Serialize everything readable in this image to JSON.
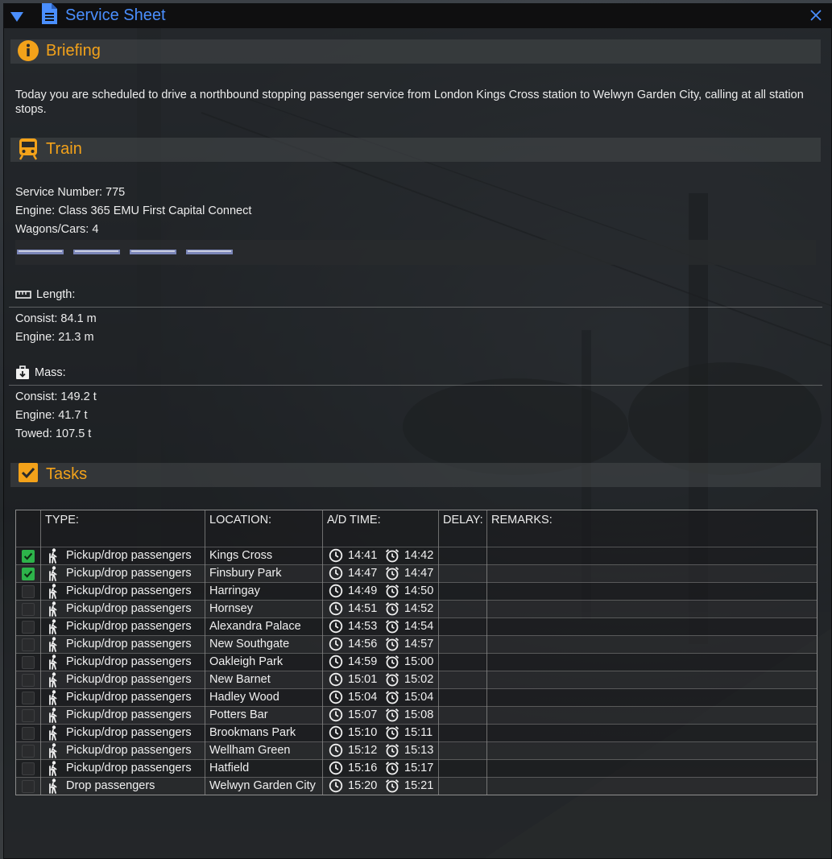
{
  "window": {
    "title": "Service Sheet"
  },
  "briefing": {
    "heading": "Briefing",
    "text": "Today you are scheduled to drive a northbound stopping passenger service from London Kings Cross station to Welwyn Garden City, calling at all station stops."
  },
  "train": {
    "heading": "Train",
    "service_number": "Service Number: 775",
    "engine": "Engine: Class 365 EMU First Capital Connect",
    "wagons": "Wagons/Cars: 4",
    "wagon_count": 4,
    "length": {
      "label": "Length:",
      "consist": "Consist: 84.1 m",
      "engine": "Engine: 21.3 m"
    },
    "mass": {
      "label": "Mass:",
      "consist": "Consist: 149.2 t",
      "engine": "Engine: 41.7 t",
      "towed": "Towed: 107.5 t"
    }
  },
  "tasks": {
    "heading": "Tasks",
    "columns": {
      "type": "TYPE:",
      "location": "LOCATION:",
      "time": "A/D TIME:",
      "delay": "DELAY:",
      "remarks": "REMARKS:"
    },
    "rows": [
      {
        "done": true,
        "type": "Pickup/drop passengers",
        "location": "Kings Cross",
        "arr": "14:41",
        "dep": "14:42"
      },
      {
        "done": true,
        "type": "Pickup/drop passengers",
        "location": "Finsbury Park",
        "arr": "14:47",
        "dep": "14:47"
      },
      {
        "done": false,
        "type": "Pickup/drop passengers",
        "location": "Harringay",
        "arr": "14:49",
        "dep": "14:50"
      },
      {
        "done": false,
        "type": "Pickup/drop passengers",
        "location": "Hornsey",
        "arr": "14:51",
        "dep": "14:52"
      },
      {
        "done": false,
        "type": "Pickup/drop passengers",
        "location": "Alexandra Palace",
        "arr": "14:53",
        "dep": "14:54"
      },
      {
        "done": false,
        "type": "Pickup/drop passengers",
        "location": "New Southgate",
        "arr": "14:56",
        "dep": "14:57"
      },
      {
        "done": false,
        "type": "Pickup/drop passengers",
        "location": "Oakleigh Park",
        "arr": "14:59",
        "dep": "15:00"
      },
      {
        "done": false,
        "type": "Pickup/drop passengers",
        "location": "New Barnet",
        "arr": "15:01",
        "dep": "15:02"
      },
      {
        "done": false,
        "type": "Pickup/drop passengers",
        "location": "Hadley Wood",
        "arr": "15:04",
        "dep": "15:04"
      },
      {
        "done": false,
        "type": "Pickup/drop passengers",
        "location": "Potters Bar",
        "arr": "15:07",
        "dep": "15:08"
      },
      {
        "done": false,
        "type": "Pickup/drop passengers",
        "location": "Brookmans Park",
        "arr": "15:10",
        "dep": "15:11"
      },
      {
        "done": false,
        "type": "Pickup/drop passengers",
        "location": "Wellham Green",
        "arr": "15:12",
        "dep": "15:13"
      },
      {
        "done": false,
        "type": "Pickup/drop passengers",
        "location": "Hatfield",
        "arr": "15:16",
        "dep": "15:17"
      },
      {
        "done": false,
        "type": "Drop passengers",
        "location": "Welwyn Garden City",
        "arr": "15:20",
        "dep": "15:21"
      }
    ]
  },
  "colors": {
    "accent": "#f3a21a",
    "title": "#4a8fff",
    "check": "#2db34a"
  }
}
